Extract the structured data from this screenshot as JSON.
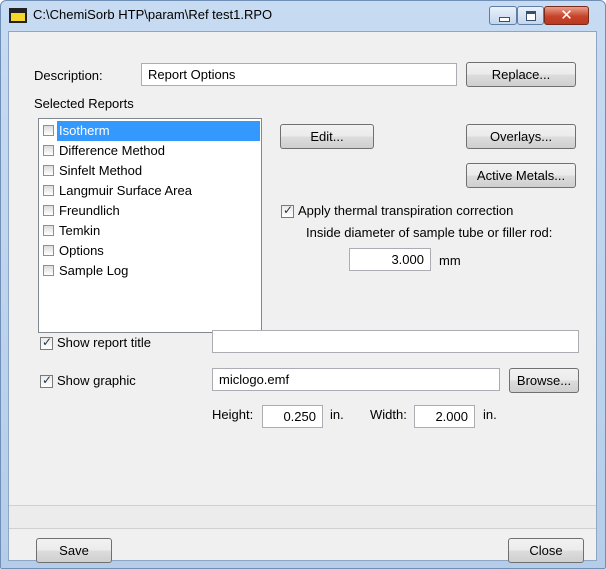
{
  "window": {
    "title": "C:\\ChemiSorb HTP\\param\\Ref test1.RPO",
    "close_glyph": "✕"
  },
  "description": {
    "label": "Description:",
    "value": "Report Options",
    "replace_button": "Replace..."
  },
  "selected_reports": {
    "heading": "Selected Reports",
    "items": [
      {
        "label": "Isotherm",
        "checked": false,
        "selected": true
      },
      {
        "label": "Difference Method",
        "checked": false,
        "selected": false
      },
      {
        "label": "Sinfelt Method",
        "checked": false,
        "selected": false
      },
      {
        "label": "Langmuir Surface Area",
        "checked": false,
        "selected": false
      },
      {
        "label": "Freundlich",
        "checked": false,
        "selected": false
      },
      {
        "label": "Temkin",
        "checked": false,
        "selected": false
      },
      {
        "label": "Options",
        "checked": false,
        "selected": false
      },
      {
        "label": "Sample Log",
        "checked": false,
        "selected": false
      }
    ]
  },
  "buttons": {
    "edit": "Edit...",
    "overlays": "Overlays...",
    "active_metals": "Active Metals...",
    "browse": "Browse...",
    "save": "Save",
    "close": "Close"
  },
  "thermal": {
    "checkbox_label": "Apply thermal transpiration correction",
    "checked": true,
    "diameter_label": "Inside diameter of sample tube or filler rod:",
    "diameter_value": "3.000",
    "diameter_unit": "mm"
  },
  "report_title": {
    "checkbox_label": "Show report title",
    "checked": true,
    "value": ""
  },
  "graphic": {
    "checkbox_label": "Show graphic",
    "checked": true,
    "file": "miclogo.emf",
    "height_label": "Height:",
    "height_value": "0.250",
    "height_unit": "in.",
    "width_label": "Width:",
    "width_value": "2.000",
    "width_unit": "in."
  }
}
